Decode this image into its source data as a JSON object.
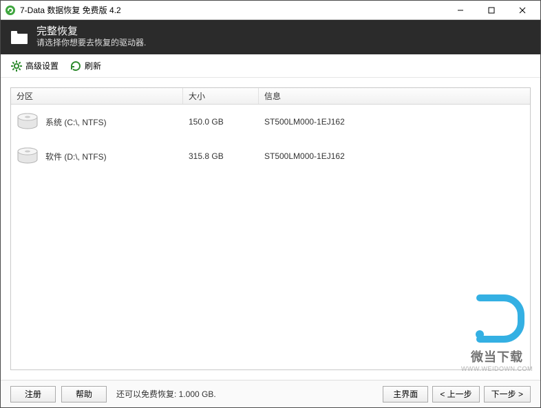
{
  "titlebar": {
    "text": "7-Data 数据恢复 免费版 4.2"
  },
  "banner": {
    "title": "完整恢复",
    "subtitle": "请选择你想要去恢复的驱动器."
  },
  "toolbar": {
    "advanced": "高级设置",
    "refresh": "刷新"
  },
  "columns": {
    "partition": "分区",
    "size": "大小",
    "info": "信息"
  },
  "drives": [
    {
      "name": "系统 (C:\\, NTFS)",
      "size": "150.0 GB",
      "info": "ST500LM000-1EJ162"
    },
    {
      "name": "软件 (D:\\, NTFS)",
      "size": "315.8 GB",
      "info": "ST500LM000-1EJ162"
    }
  ],
  "footer": {
    "register": "注册",
    "help": "帮助",
    "quota": "还可以免费恢复: 1.000 GB.",
    "home": "主界面",
    "prev": "< 上一步",
    "next": "下一步 >"
  },
  "watermark": {
    "text": "微当下载",
    "url": "WWW.WEIDOWN.COM"
  }
}
